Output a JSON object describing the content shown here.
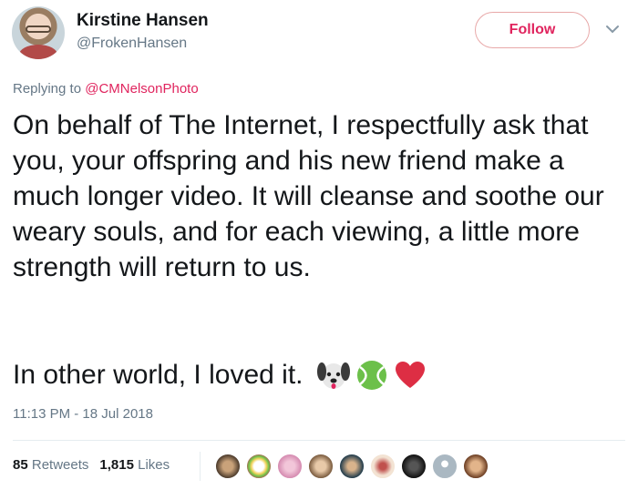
{
  "user": {
    "name": "Kirstine Hansen",
    "handle": "@FrokenHansen"
  },
  "follow_label": "Follow",
  "reply": {
    "prefix": "Replying to ",
    "mention": "@CMNelsonPhoto"
  },
  "tweet": {
    "text": "On behalf of The Internet, I respectfully ask that you, your offspring and his new friend make a much longer video. It will cleanse and soothe our weary souls, and for each viewing, a little more strength will return to us.",
    "line2": "In other world, I loved it.",
    "emojis": [
      "dog-face",
      "tennis-ball",
      "red-heart"
    ]
  },
  "timestamp": "11:13 PM - 18 Jul 2018",
  "stats": {
    "retweets_count": "85",
    "retweets_label": "Retweets",
    "likes_count": "1,815",
    "likes_label": "Likes"
  },
  "colors": {
    "accent": "#e0245e",
    "secondary_text": "#657786",
    "text": "#14171a"
  }
}
